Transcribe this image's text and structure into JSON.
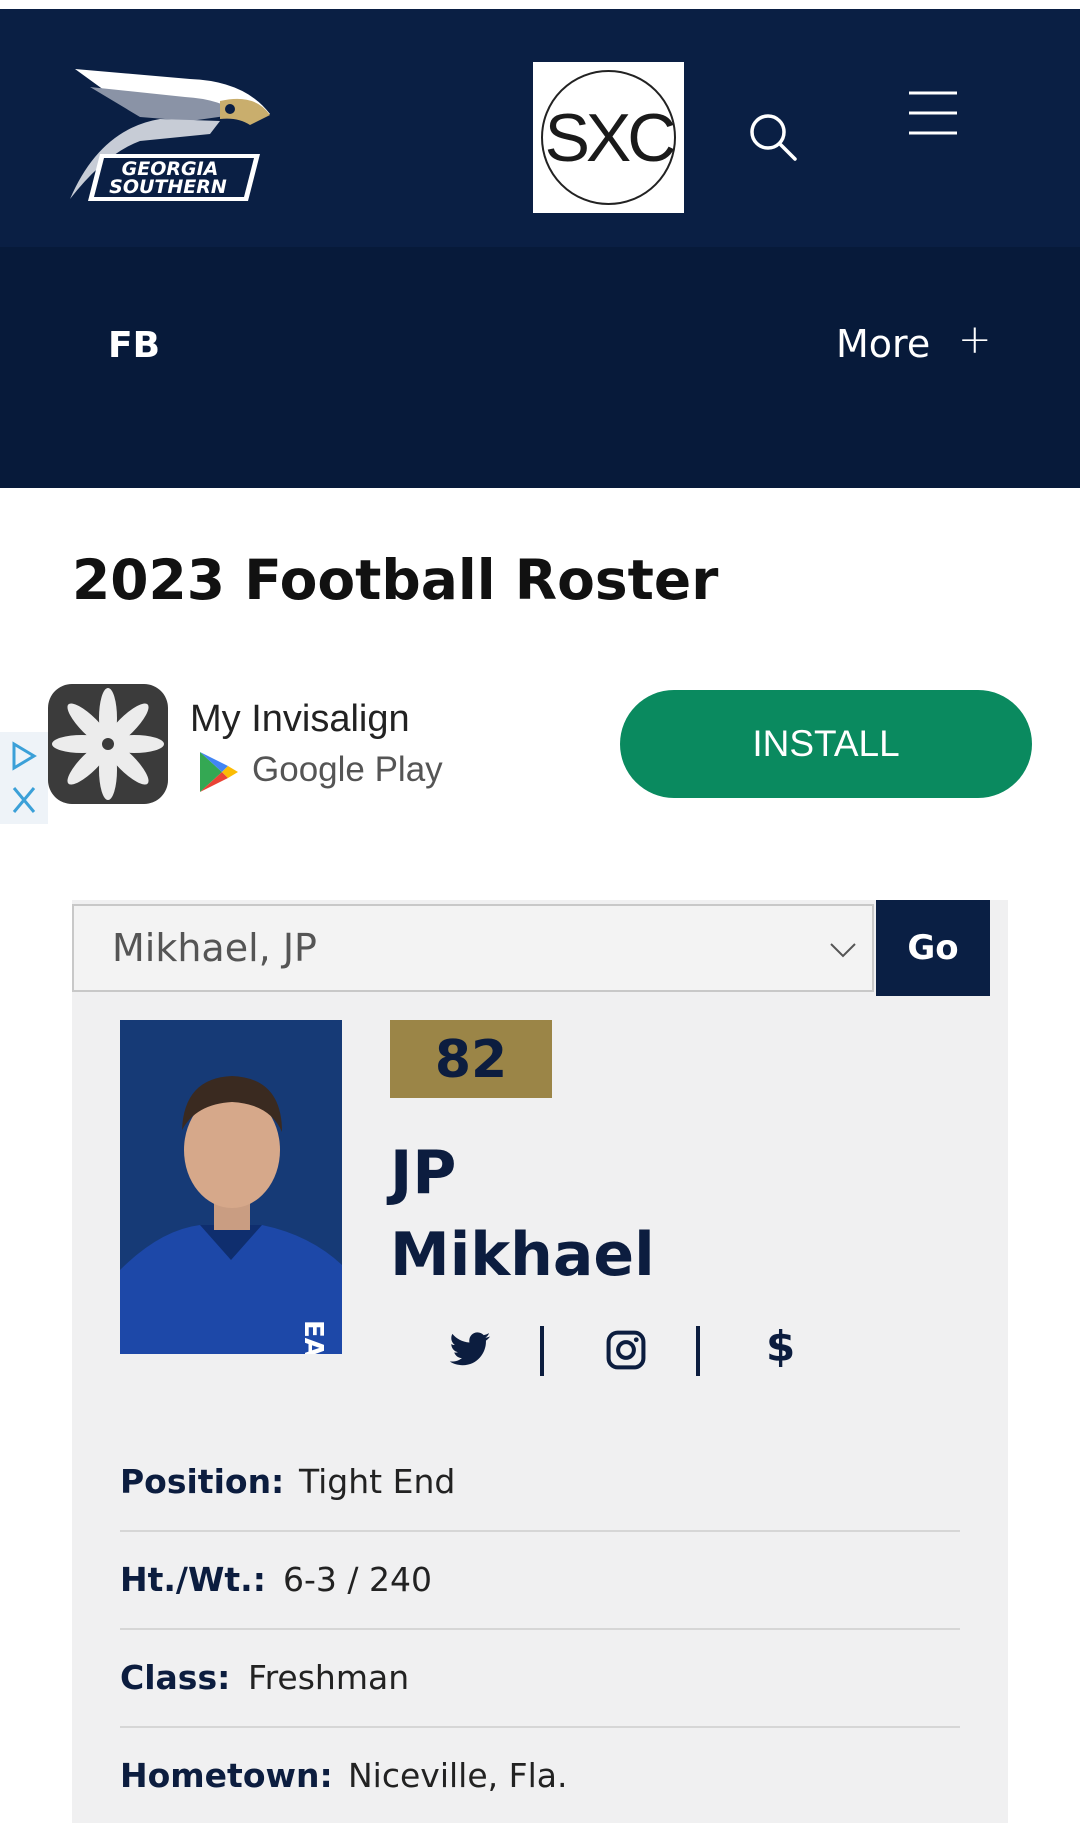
{
  "header": {
    "logo_line1": "GEORGIA",
    "logo_line2": "SOUTHERN",
    "sponsor_text": "SXC"
  },
  "subnav": {
    "sport": "FB",
    "more_label": "More",
    "more_icon": "+"
  },
  "page": {
    "title": "2023 Football Roster"
  },
  "ad": {
    "app_name": "My Invisalign",
    "store_name": "Google Play",
    "install_label": "INSTALL"
  },
  "roster_select": {
    "selected": "Mikhael, JP",
    "go_label": "Go"
  },
  "player": {
    "number": "82",
    "first_name": "JP",
    "last_name": "Mikhael",
    "social": {
      "twitter_icon": "twitter-icon",
      "instagram_icon": "instagram-icon",
      "nil_symbol": "$"
    },
    "details": [
      {
        "label": "Position:",
        "value": "Tight End"
      },
      {
        "label": "Ht./Wt.:",
        "value": "6-3 / 240"
      },
      {
        "label": "Class:",
        "value": "Freshman"
      },
      {
        "label": "Hometown:",
        "value": "Niceville, Fla."
      }
    ]
  },
  "colors": {
    "navy": "#0a1f44",
    "gold": "#9b8547",
    "install_green": "#0a8a5f"
  }
}
